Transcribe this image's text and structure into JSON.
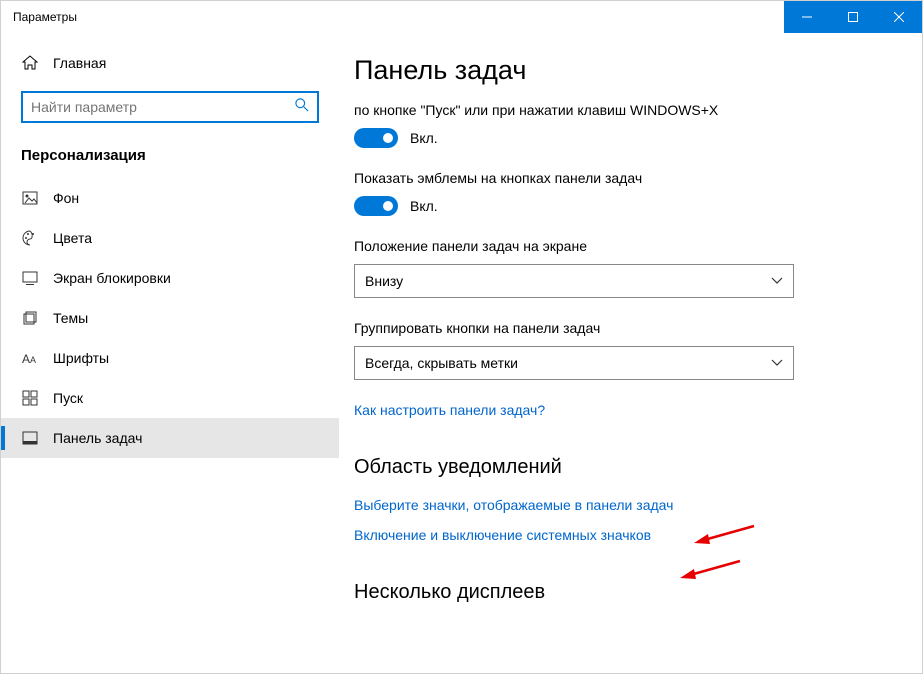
{
  "window": {
    "title": "Параметры"
  },
  "sidebar": {
    "home": "Главная",
    "search_placeholder": "Найти параметр",
    "category": "Персонализация",
    "items": [
      {
        "icon": "picture",
        "label": "Фон"
      },
      {
        "icon": "palette",
        "label": "Цвета"
      },
      {
        "icon": "lockscreen",
        "label": "Экран блокировки"
      },
      {
        "icon": "themes",
        "label": "Темы"
      },
      {
        "icon": "fonts",
        "label": "Шрифты"
      },
      {
        "icon": "start",
        "label": "Пуск"
      },
      {
        "icon": "taskbar",
        "label": "Панель задач"
      }
    ]
  },
  "main": {
    "title": "Панель задач",
    "setting1_label": "по кнопке \"Пуск\" или при нажатии клавиш WINDOWS+X",
    "setting1_state": "Вкл.",
    "setting2_label": "Показать эмблемы на кнопках панели задач",
    "setting2_state": "Вкл.",
    "position_label": "Положение панели задач на экране",
    "position_value": "Внизу",
    "combine_label": "Группировать кнопки на панели задач",
    "combine_value": "Всегда, скрывать метки",
    "how_link": "Как настроить панели задач?",
    "notif_heading": "Область уведомлений",
    "notif_link1": "Выберите значки, отображаемые в панели задач",
    "notif_link2": "Включение и выключение системных значков",
    "multi_heading": "Несколько дисплеев"
  }
}
